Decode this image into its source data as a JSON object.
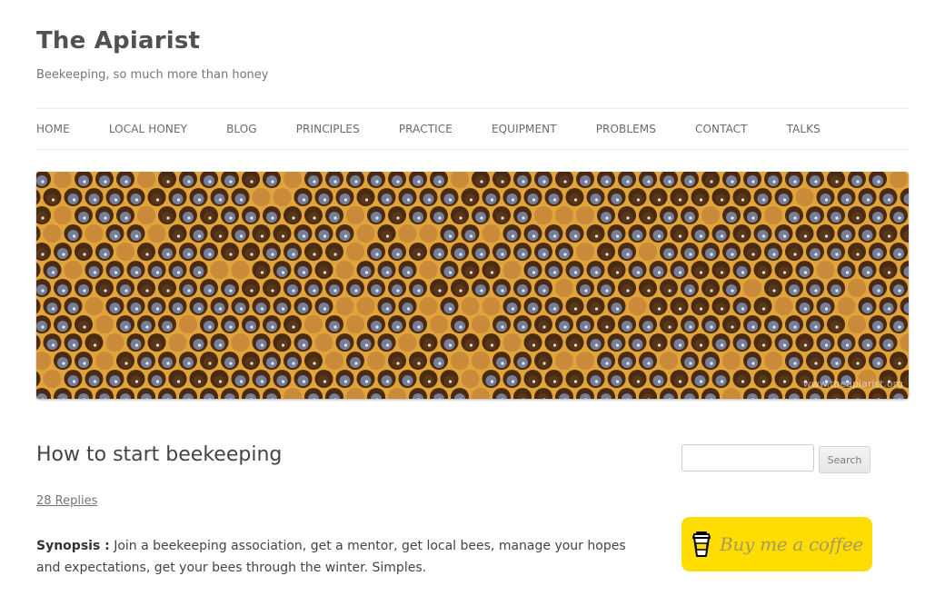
{
  "site": {
    "title": "The Apiarist",
    "description": "Beekeeping, so much more than honey"
  },
  "nav": {
    "items": [
      {
        "label": "HOME"
      },
      {
        "label": "LOCAL HONEY"
      },
      {
        "label": "BLOG"
      },
      {
        "label": "PRINCIPLES"
      },
      {
        "label": "PRACTICE"
      },
      {
        "label": "EQUIPMENT"
      },
      {
        "label": "PROBLEMS"
      },
      {
        "label": "CONTACT"
      },
      {
        "label": "TALKS"
      }
    ]
  },
  "header_image": {
    "watermark": "www.theapiarist.org",
    "colors": {
      "wax": "#e0a43a",
      "cell_dark": "#4a2a10",
      "nectar": "#7a88a8",
      "pollen": "#c98a3a"
    }
  },
  "post": {
    "title": "How to start beekeeping",
    "replies": "28 Replies",
    "synopsis_label": "Synopsis :",
    "synopsis_text": " Join a beekeeping association, get a mentor, get local bees, manage your hopes and expectations, get your bees through the winter. Simples."
  },
  "sidebar": {
    "search": {
      "value": "",
      "placeholder": "",
      "button_label": "Search"
    },
    "coffee": {
      "label": "Buy me a coffee",
      "icon": "coffee-cup-icon",
      "color": "#ffdd00"
    }
  }
}
